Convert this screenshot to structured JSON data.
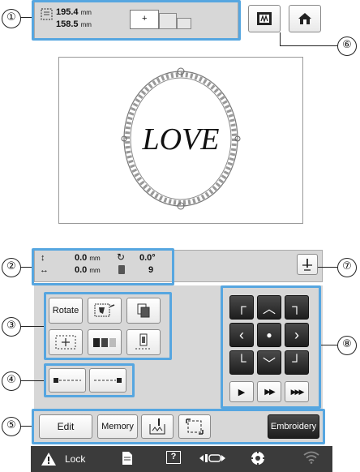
{
  "callouts": {
    "c1": "①",
    "c2": "②",
    "c3": "③",
    "c4": "④",
    "c5": "⑤",
    "c6": "⑥",
    "c7": "⑦",
    "c8": "⑧"
  },
  "size_display": {
    "height_value": "195.4",
    "height_unit": "mm",
    "width_value": "158.5",
    "width_unit": "mm"
  },
  "preview": {
    "design_text": "LOVE"
  },
  "position_display": {
    "vertical_value": "0.0",
    "vertical_unit": "mm",
    "horizontal_value": "0.0",
    "horizontal_unit": "mm",
    "angle_value": "0.0°",
    "color_count": "9"
  },
  "edit_buttons": {
    "rotate_label": "Rotate"
  },
  "bottom_bar": {
    "edit_label": "Edit",
    "memory_label": "Memory",
    "embroidery_label": "Embroidery"
  },
  "status_bar": {
    "lock_label": "Lock",
    "help_label": "?"
  }
}
